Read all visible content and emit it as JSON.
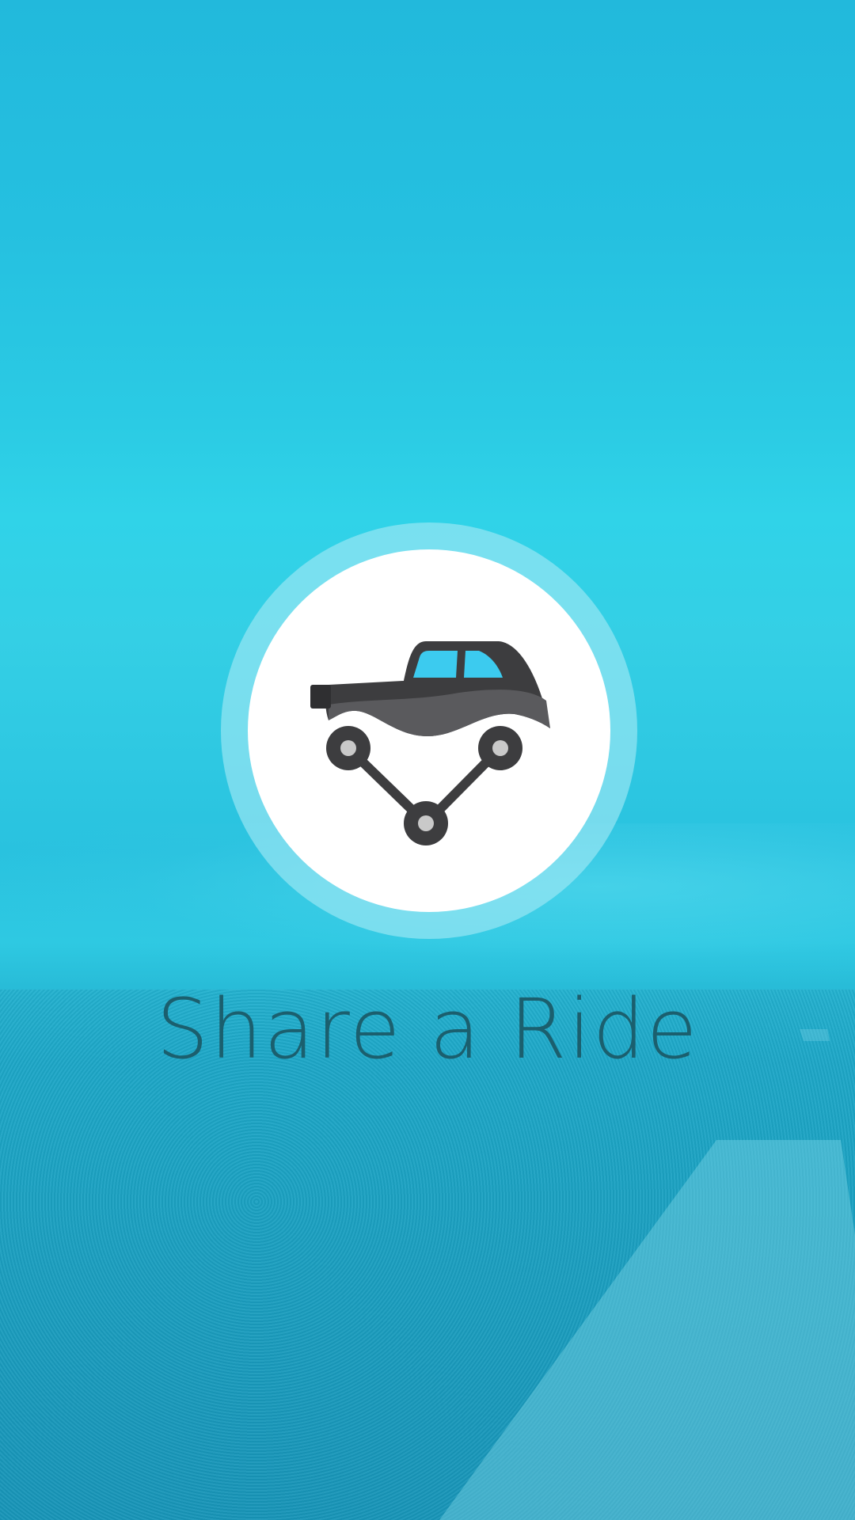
{
  "app": {
    "name": "Share a Ride",
    "logo_icon": "car-share-icon"
  },
  "colors": {
    "background": "#29c2df",
    "logo_ring": "#a0e8f4",
    "logo_disc": "#ffffff",
    "car_body": "#3d3d3f",
    "car_window": "#3ccbef",
    "title_text": "#1b5f6e"
  }
}
